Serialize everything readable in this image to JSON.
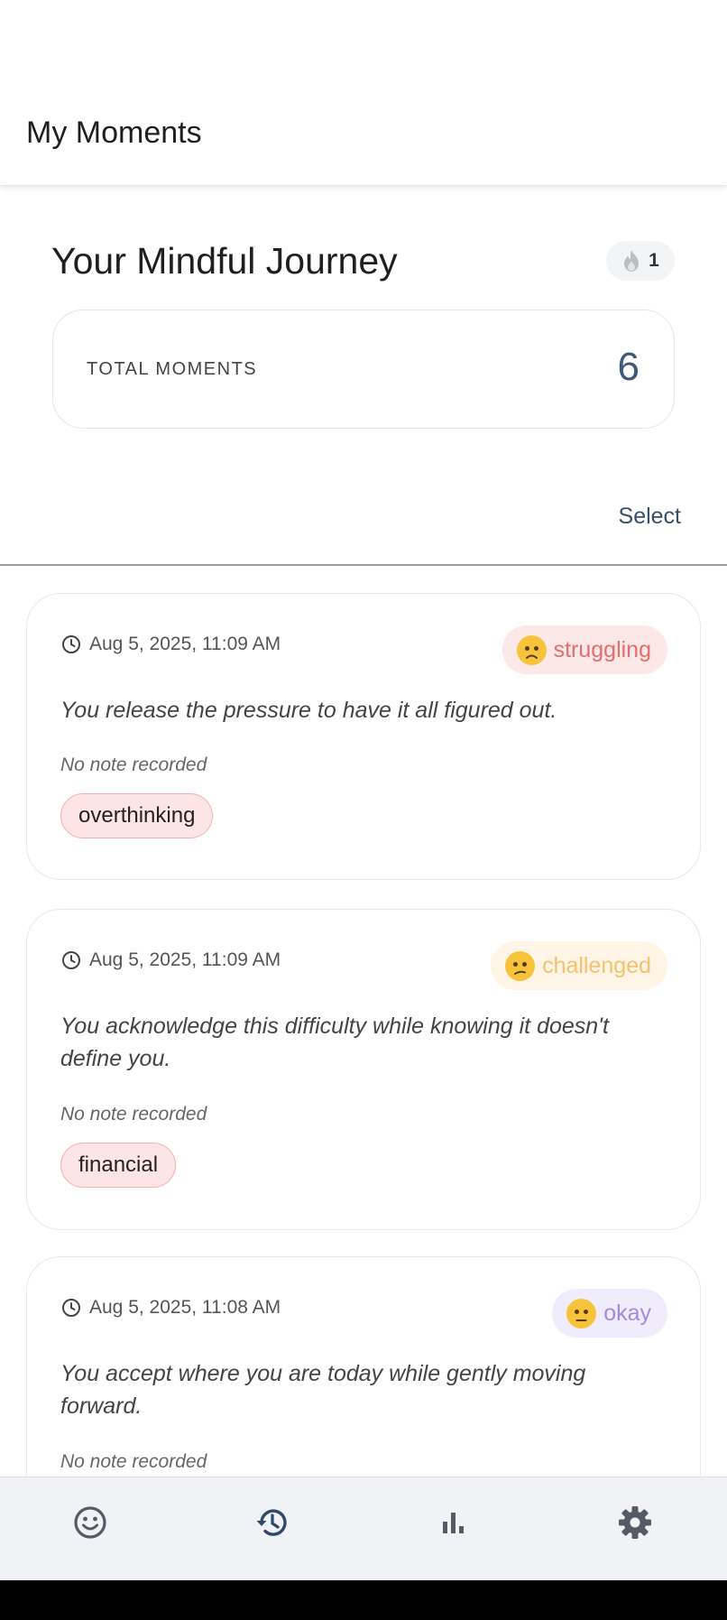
{
  "header": {
    "title": "My Moments"
  },
  "journey": {
    "title": "Your Mindful Journey",
    "streak_icon": "flame-icon",
    "streak_count": "1"
  },
  "total": {
    "label": "TOTAL MOMENTS",
    "value": "6"
  },
  "select_label": "Select",
  "moments": [
    {
      "timestamp": "Aug 5, 2025, 11:09 AM",
      "mood": "struggling",
      "mood_emoji": "disappointed-face-icon",
      "mood_color": "#e46d6d",
      "mood_bg": "#fde8e8",
      "affirmation": "You release the pressure to have it all figured out.",
      "note": "No note recorded",
      "tag": "overthinking"
    },
    {
      "timestamp": "Aug 5, 2025, 11:09 AM",
      "mood": "challenged",
      "mood_emoji": "confused-face-icon",
      "mood_color": "#f5c16c",
      "mood_bg": "#fef5e6",
      "affirmation": "You acknowledge this difficulty while knowing it doesn't define you.",
      "note": "No note recorded",
      "tag": "financial"
    },
    {
      "timestamp": "Aug 5, 2025, 11:08 AM",
      "mood": "okay",
      "mood_emoji": "neutral-face-icon",
      "mood_color": "#a48be0",
      "mood_bg": "#f1ecfb",
      "affirmation": "You accept where you are today while gently moving forward.",
      "note": "No note recorded"
    }
  ],
  "nav": [
    {
      "icon": "smiley-icon",
      "color": "#555b66"
    },
    {
      "icon": "history-icon",
      "color": "#2f4a68",
      "active": true
    },
    {
      "icon": "bar-chart-icon",
      "color": "#555b66"
    },
    {
      "icon": "settings-gear-icon",
      "color": "#555b66"
    }
  ]
}
